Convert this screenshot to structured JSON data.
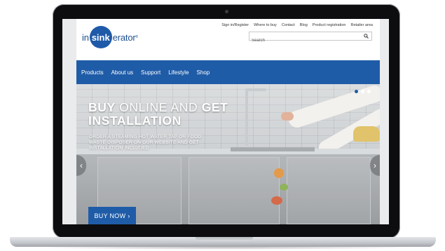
{
  "brand": {
    "logo_prefix": "in",
    "logo_circle": "sink",
    "logo_suffix": "erator",
    "logo_tm": "®"
  },
  "header": {
    "top_links": [
      "Sign in/Register",
      "Where to buy",
      "Contact",
      "Blog",
      "Product registration",
      "Retailer area"
    ],
    "search": {
      "placeholder": "Search",
      "icon": "search-icon"
    }
  },
  "nav": {
    "items": [
      "Products",
      "About us",
      "Support",
      "Lifestyle",
      "Shop"
    ]
  },
  "hero": {
    "headline_part1": "BUY",
    "headline_part2": " ONLINE AND ",
    "headline_part3": "GET",
    "headline_line2": "INSTALLATION",
    "subhead": "ORDER A STEAMING HOT WATER TAP OR FOOD WASTE DISPOSER ON OUR WEBSITE AND GET INSTALLATION INCLUDED",
    "cta_label": "BUY NOW ›",
    "prev_arrow": "‹",
    "next_arrow": "›",
    "carousel_dots": 3,
    "active_dot": 1
  },
  "colors": {
    "brand_blue": "#1f5ca8",
    "logo_blue": "#1e5aa8"
  }
}
